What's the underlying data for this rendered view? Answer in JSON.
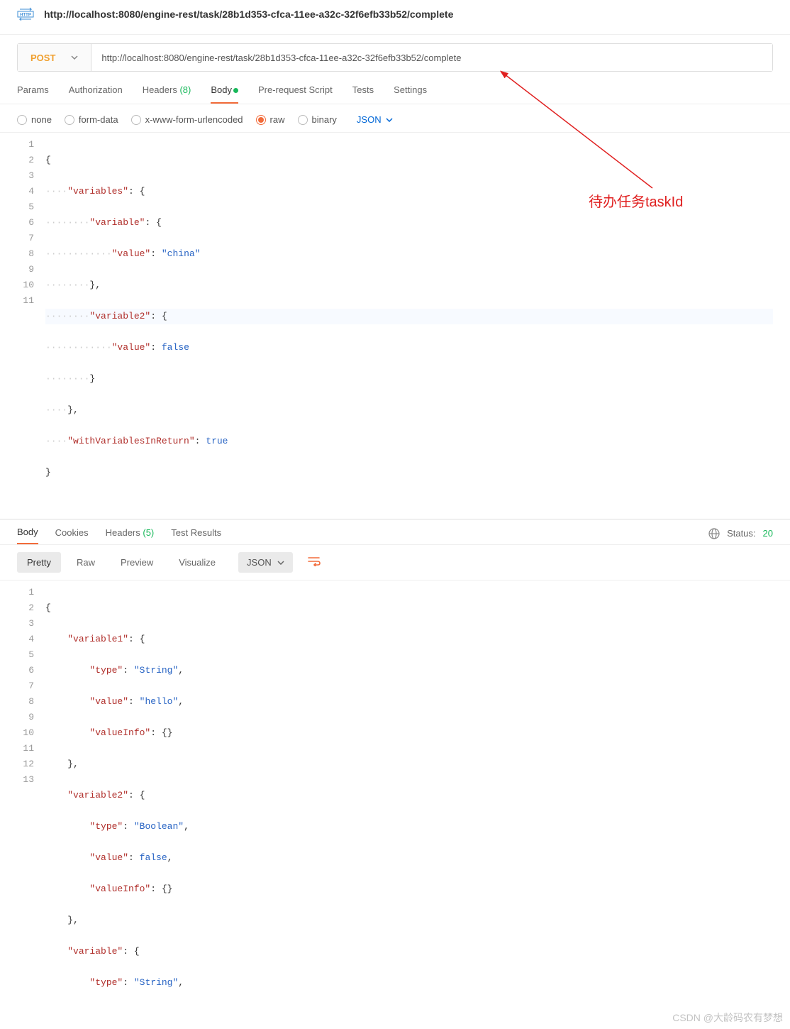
{
  "header": {
    "icon_label": "HTTP",
    "title": "http://localhost:8080/engine-rest/task/28b1d353-cfca-11ee-a32c-32f6efb33b52/complete"
  },
  "request": {
    "method": "POST",
    "url": "http://localhost:8080/engine-rest/task/28b1d353-cfca-11ee-a32c-32f6efb33b52/complete"
  },
  "req_tabs": {
    "params": "Params",
    "auth": "Authorization",
    "headers_label": "Headers",
    "headers_count": "(8)",
    "body": "Body",
    "prereq": "Pre-request Script",
    "tests": "Tests",
    "settings": "Settings"
  },
  "body_types": {
    "none": "none",
    "formdata": "form-data",
    "xwww": "x-www-form-urlencoded",
    "raw": "raw",
    "binary": "binary",
    "json": "JSON"
  },
  "req_body_lines": [
    "1",
    "2",
    "3",
    "4",
    "5",
    "6",
    "7",
    "8",
    "9",
    "10",
    "11"
  ],
  "req_body": {
    "k_variables": "\"variables\"",
    "k_variable": "\"variable\"",
    "k_value": "\"value\"",
    "v_china": "\"china\"",
    "k_variable2": "\"variable2\"",
    "v_false": "false",
    "k_withVars": "\"withVariablesInReturn\"",
    "v_true": "true"
  },
  "resp_tabs": {
    "body": "Body",
    "cookies": "Cookies",
    "headers_label": "Headers",
    "headers_count": "(5)",
    "tests": "Test Results"
  },
  "resp_status": {
    "label": "Status:",
    "code": "20"
  },
  "view_modes": {
    "pretty": "Pretty",
    "raw": "Raw",
    "preview": "Preview",
    "visualize": "Visualize",
    "json": "JSON"
  },
  "resp_body_lines": [
    "1",
    "2",
    "3",
    "4",
    "5",
    "6",
    "7",
    "8",
    "9",
    "10",
    "11",
    "12",
    "13"
  ],
  "resp_body": {
    "k_variable1": "\"variable1\"",
    "k_type": "\"type\"",
    "v_String": "\"String\"",
    "k_value": "\"value\"",
    "v_hello": "\"hello\"",
    "k_valueInfo": "\"valueInfo\"",
    "k_variable2": "\"variable2\"",
    "v_Boolean": "\"Boolean\"",
    "v_false": "false",
    "k_variable": "\"variable\""
  },
  "annotation": "待办任务taskId",
  "watermark": "CSDN @大龄码农有梦想"
}
